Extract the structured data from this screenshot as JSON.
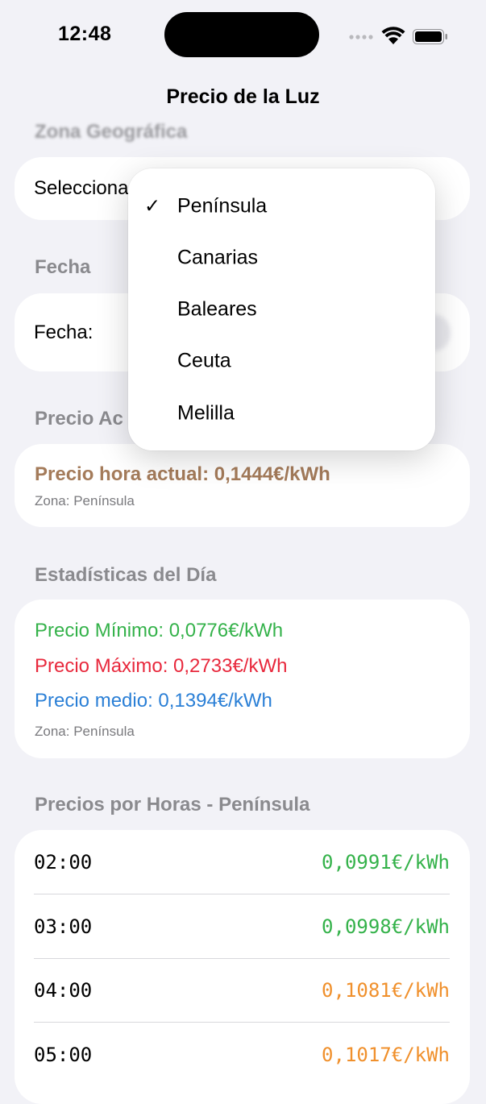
{
  "status_bar": {
    "time": "12:48"
  },
  "nav": {
    "title": "Precio de la Luz"
  },
  "zona": {
    "header": "Zona Geográfica",
    "select_label": "Selecciona"
  },
  "fecha": {
    "header": "Fecha",
    "label": "Fecha:"
  },
  "precio_actual": {
    "header": "Precio Ac",
    "current": "Precio hora actual: 0,1444€/kWh",
    "zone": "Zona: Península"
  },
  "estadisticas": {
    "header": "Estadísticas del Día",
    "min": "Precio Mínimo: 0,0776€/kWh",
    "max": "Precio Máximo: 0,2733€/kWh",
    "avg": "Precio medio: 0,1394€/kWh",
    "zone": "Zona: Península"
  },
  "horas": {
    "header": "Precios por Horas - Península",
    "rows": [
      {
        "hour": "02:00",
        "price": "0,0991€/kWh",
        "level": "green"
      },
      {
        "hour": "03:00",
        "price": "0,0998€/kWh",
        "level": "green"
      },
      {
        "hour": "04:00",
        "price": "0,1081€/kWh",
        "level": "orange"
      },
      {
        "hour": "05:00",
        "price": "0,1017€/kWh",
        "level": "orange"
      }
    ]
  },
  "menu": {
    "items": [
      {
        "label": "Península",
        "selected": true,
        "check": "✓"
      },
      {
        "label": "Canarias",
        "selected": false
      },
      {
        "label": "Baleares",
        "selected": false
      },
      {
        "label": "Ceuta",
        "selected": false
      },
      {
        "label": "Melilla",
        "selected": false
      }
    ]
  },
  "colors": {
    "background": "#f2f2f7",
    "current_price": "#a47b5a",
    "min": "#34b24a",
    "max": "#e8283c",
    "avg": "#2a7fd6",
    "price_low": "#34b24a",
    "price_mid": "#f0902c"
  }
}
